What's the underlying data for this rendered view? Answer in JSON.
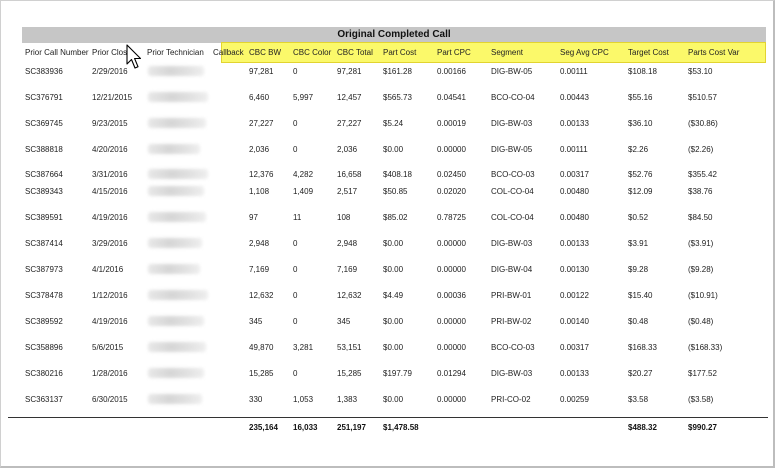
{
  "report": {
    "title": "Original Completed Call",
    "columns": {
      "prior_call_number": "Prior Call Number",
      "prior_close": "Prior Clos",
      "prior_technician": "Prior Technician",
      "callback": "Callback",
      "cbc_bw": "CBC BW",
      "cbc_color": "CBC Color",
      "cbc_total": "CBC Total",
      "part_cost": "Part Cost",
      "part_cpc": "Part CPC",
      "segment": "Segment",
      "seg_avg_cpc": "Seg Avg CPC",
      "target_cost": "Target Cost",
      "parts_cost_var": "Parts Cost Var"
    },
    "rows": [
      {
        "call": "SC383936",
        "close": "2/29/2016",
        "bw": "97,281",
        "color": "0",
        "total": "97,281",
        "part_cost": "$161.28",
        "part_cpc": "0.00166",
        "segment": "DIG-BW-05",
        "seg_avg": "0.00111",
        "target": "$108.18",
        "var": "$53.10"
      },
      {
        "call": "SC376791",
        "close": "12/21/2015",
        "bw": "6,460",
        "color": "5,997",
        "total": "12,457",
        "part_cost": "$565.73",
        "part_cpc": "0.04541",
        "segment": "BCO-CO-04",
        "seg_avg": "0.00443",
        "target": "$55.16",
        "var": "$510.57"
      },
      {
        "call": "SC369745",
        "close": "9/23/2015",
        "bw": "27,227",
        "color": "0",
        "total": "27,227",
        "part_cost": "$5.24",
        "part_cpc": "0.00019",
        "segment": "DIG-BW-03",
        "seg_avg": "0.00133",
        "target": "$36.10",
        "var": "($30.86)"
      },
      {
        "call": "SC388818",
        "close": "4/20/2016",
        "bw": "2,036",
        "color": "0",
        "total": "2,036",
        "part_cost": "$0.00",
        "part_cpc": "0.00000",
        "segment": "DIG-BW-05",
        "seg_avg": "0.00111",
        "target": "$2.26",
        "var": "($2.26)"
      },
      {
        "call": "SC387664",
        "close": "3/31/2016",
        "bw": "12,376",
        "color": "4,282",
        "total": "16,658",
        "part_cost": "$408.18",
        "part_cpc": "0.02450",
        "segment": "BCO-CO-03",
        "seg_avg": "0.00317",
        "target": "$52.76",
        "var": "$355.42"
      },
      {
        "call": "SC389343",
        "close": "4/15/2016",
        "bw": "1,108",
        "color": "1,409",
        "total": "2,517",
        "part_cost": "$50.85",
        "part_cpc": "0.02020",
        "segment": "COL-CO-04",
        "seg_avg": "0.00480",
        "target": "$12.09",
        "var": "$38.76"
      },
      {
        "call": "SC389591",
        "close": "4/19/2016",
        "bw": "97",
        "color": "11",
        "total": "108",
        "part_cost": "$85.02",
        "part_cpc": "0.78725",
        "segment": "COL-CO-04",
        "seg_avg": "0.00480",
        "target": "$0.52",
        "var": "$84.50"
      },
      {
        "call": "SC387414",
        "close": "3/29/2016",
        "bw": "2,948",
        "color": "0",
        "total": "2,948",
        "part_cost": "$0.00",
        "part_cpc": "0.00000",
        "segment": "DIG-BW-03",
        "seg_avg": "0.00133",
        "target": "$3.91",
        "var": "($3.91)"
      },
      {
        "call": "SC387973",
        "close": "4/1/2016",
        "bw": "7,169",
        "color": "0",
        "total": "7,169",
        "part_cost": "$0.00",
        "part_cpc": "0.00000",
        "segment": "DIG-BW-04",
        "seg_avg": "0.00130",
        "target": "$9.28",
        "var": "($9.28)"
      },
      {
        "call": "SC378478",
        "close": "1/12/2016",
        "bw": "12,632",
        "color": "0",
        "total": "12,632",
        "part_cost": "$4.49",
        "part_cpc": "0.00036",
        "segment": "PRI-BW-01",
        "seg_avg": "0.00122",
        "target": "$15.40",
        "var": "($10.91)"
      },
      {
        "call": "SC389592",
        "close": "4/19/2016",
        "bw": "345",
        "color": "0",
        "total": "345",
        "part_cost": "$0.00",
        "part_cpc": "0.00000",
        "segment": "PRI-BW-02",
        "seg_avg": "0.00140",
        "target": "$0.48",
        "var": "($0.48)"
      },
      {
        "call": "SC358896",
        "close": "5/6/2015",
        "bw": "49,870",
        "color": "3,281",
        "total": "53,151",
        "part_cost": "$0.00",
        "part_cpc": "0.00000",
        "segment": "BCO-CO-03",
        "seg_avg": "0.00317",
        "target": "$168.33",
        "var": "($168.33)"
      },
      {
        "call": "SC380216",
        "close": "1/28/2016",
        "bw": "15,285",
        "color": "0",
        "total": "15,285",
        "part_cost": "$197.79",
        "part_cpc": "0.01294",
        "segment": "DIG-BW-03",
        "seg_avg": "0.00133",
        "target": "$20.27",
        "var": "$177.52"
      },
      {
        "call": "SC363137",
        "close": "6/30/2015",
        "bw": "330",
        "color": "1,053",
        "total": "1,383",
        "part_cost": "$0.00",
        "part_cpc": "0.00000",
        "segment": "PRI-CO-02",
        "seg_avg": "0.00259",
        "target": "$3.58",
        "var": "($3.58)"
      }
    ],
    "totals": {
      "bw": "235,164",
      "color": "16,033",
      "total": "251,197",
      "part_cost": "$1,478.58",
      "target": "$488.32",
      "var": "$990.27"
    },
    "highlight_color": "#fbf96a"
  }
}
